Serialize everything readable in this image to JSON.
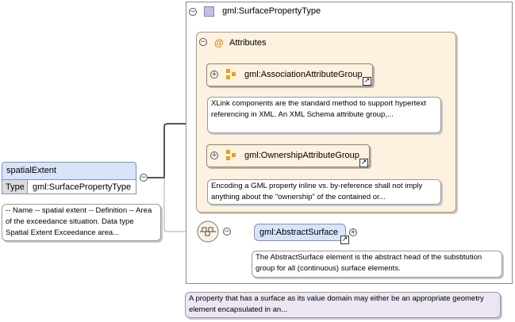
{
  "complex_type": {
    "name": "gml:SurfacePropertyType"
  },
  "attributes": {
    "label": "Attributes",
    "icon": "@"
  },
  "groups": [
    {
      "name": "gml:AssociationAttributeGroup",
      "doc": "XLink components are the standard method to support hypertext referencing in XML. An XML Schema attribute group,..."
    },
    {
      "name": "gml:OwnershipAttributeGroup",
      "doc": "Encoding a GML property inline vs. by-reference shall not imply anything about the \"ownership\" of the contained or..."
    }
  ],
  "element": {
    "name": "spatialExtent",
    "type_label": "Type",
    "type_value": "gml:SurfacePropertyType",
    "doc": "-- Name -- spatial extent -- Definition -- Area of the exceedance situation. Data type Spatial Extent Exceedance area..."
  },
  "abstract_surface": {
    "name": "gml:AbstractSurface",
    "doc": "The AbstractSurface element is the abstract head of the substitution group for all (continuous) surface elements."
  },
  "type_doc": "A property that has a surface as its value domain may either be an appropriate geometry element encapsulated in an...",
  "toggles": {
    "collapse": "−",
    "expand": "+"
  },
  "icons": [
    "complex-type-icon",
    "attribute-icon",
    "attribute-group-icon",
    "link-arrow-icon",
    "sequence-icon"
  ],
  "colors": {
    "attributes_fill": "#fdf1df",
    "element_fill": "#d8e4f7",
    "type_doc_fill": "#ebe6f2",
    "connector": "#555555"
  }
}
